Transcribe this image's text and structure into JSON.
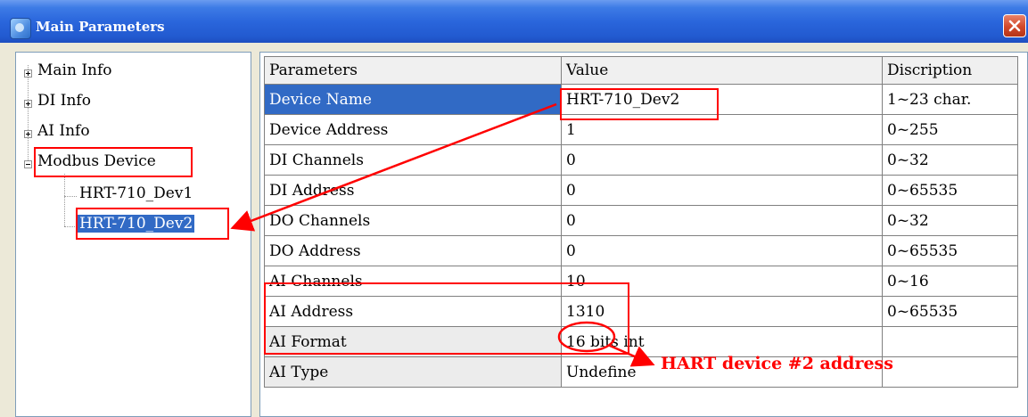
{
  "window": {
    "title": "Main Parameters"
  },
  "tree": {
    "nodes": [
      {
        "label": "Main Info",
        "expander": "plus"
      },
      {
        "label": "DI Info",
        "expander": "plus"
      },
      {
        "label": "AI Info",
        "expander": "plus"
      },
      {
        "label": "Modbus Device",
        "expander": "minus"
      }
    ],
    "children": [
      {
        "label": "HRT-710_Dev1",
        "selected": false
      },
      {
        "label": "HRT-710_Dev2",
        "selected": true
      }
    ]
  },
  "grid": {
    "headers": [
      "Parameters",
      "Value",
      "Discription"
    ],
    "rows": [
      {
        "param": "Device Name",
        "value": "HRT-710_Dev2",
        "desc": "1~23 char."
      },
      {
        "param": "Device Address",
        "value": "1",
        "desc": "0~255"
      },
      {
        "param": "DI Channels",
        "value": "0",
        "desc": "0~32"
      },
      {
        "param": "DI Address",
        "value": "0",
        "desc": "0~65535"
      },
      {
        "param": "DO Channels",
        "value": "0",
        "desc": "0~32"
      },
      {
        "param": "DO Address",
        "value": "0",
        "desc": "0~65535"
      },
      {
        "param": "AI Channels",
        "value": "10",
        "desc": "0~16"
      },
      {
        "param": "AI Address",
        "value": "1310",
        "desc": "0~65535"
      },
      {
        "param": "AI Format",
        "value": "16 bits int",
        "desc": ""
      },
      {
        "param": "AI Type",
        "value": "Undefine",
        "desc": ""
      }
    ]
  },
  "annotation": {
    "text": "HART device #2 address"
  },
  "colors": {
    "annotation_red": "#ff0000",
    "selection_blue": "#316ac5",
    "titlebar_blue": "#2a66dc"
  }
}
